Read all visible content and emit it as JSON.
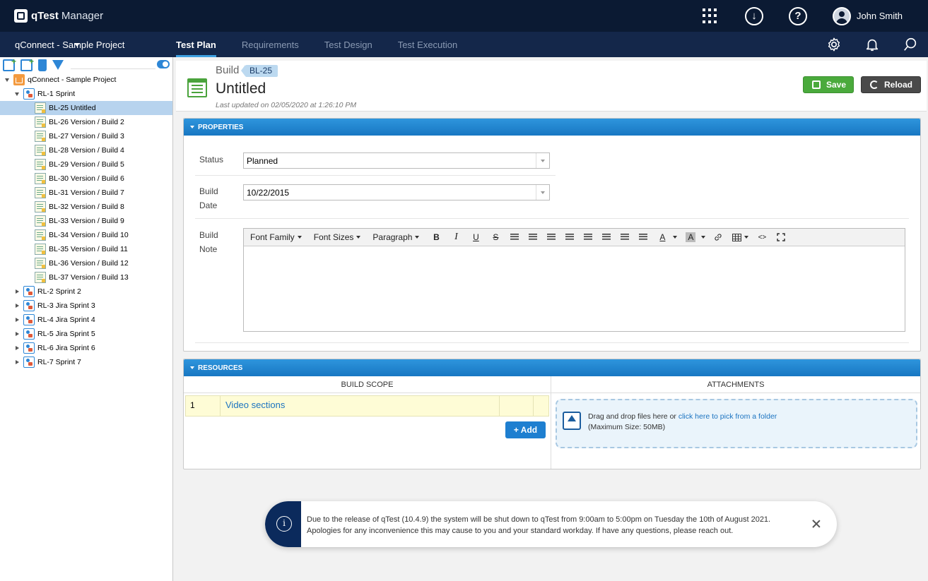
{
  "topbar": {
    "brand": "qTest",
    "product": "Manager",
    "user_name": "John Smith",
    "download_glyph": "↓",
    "help_glyph": "?"
  },
  "navbar": {
    "project": "qConnect - Sample Project",
    "tabs": [
      {
        "label": "Test Plan",
        "active": true
      },
      {
        "label": "Requirements",
        "active": false
      },
      {
        "label": "Test Design",
        "active": false
      },
      {
        "label": "Test Execution",
        "active": false
      }
    ]
  },
  "tree": {
    "root": "qConnect - Sample Project",
    "sprint1": "RL-1 Sprint",
    "builds": [
      "BL-25 Untitled",
      "BL-26 Version / Build 2",
      "BL-27 Version / Build 3",
      "BL-28 Version / Build 4",
      "BL-29 Version / Build 5",
      "BL-30 Version / Build 6",
      "BL-31 Version / Build 7",
      "BL-32 Version / Build 8",
      "BL-33 Version / Build 9",
      "BL-34 Version / Build 10",
      "BL-35 Version / Build 11",
      "BL-36 Version / Build 12",
      "BL-37 Version / Build 13"
    ],
    "releases": [
      "RL-2 Sprint 2",
      "RL-3 Jira Sprint 3",
      "RL-4 Jira Sprint 4",
      "RL-5 Jira Sprint 5",
      "RL-6 Jira Sprint 6",
      "RL-7 Sprint 7"
    ]
  },
  "header": {
    "type": "Build",
    "badge": "BL-25",
    "title": "Untitled",
    "updated": "Last updated on 02/05/2020 at 1:26:10 PM",
    "save_label": "Save",
    "reload_label": "Reload"
  },
  "properties": {
    "heading": "PROPERTIES",
    "status_label": "Status",
    "status_value": "Planned",
    "build_date_label_1": "Build",
    "build_date_label_2": "Date",
    "build_date_value": "10/22/2015",
    "build_note_label_1": "Build",
    "build_note_label_2": "Note",
    "editor": {
      "font_family": "Font Family",
      "font_sizes": "Font Sizes",
      "paragraph": "Paragraph",
      "bold": "B",
      "italic": "I",
      "underline": "U",
      "strike": "S",
      "text_color": "A",
      "bg_color": "A",
      "code": "<>"
    }
  },
  "resources": {
    "heading": "RESOURCES",
    "scope_header": "BUILD SCOPE",
    "attachments_header": "ATTACHMENTS",
    "scope_rows": [
      {
        "num": "1",
        "name": "Video sections"
      }
    ],
    "add_label": "+ Add",
    "drop_text": "Drag and drop files here or ",
    "drop_link": "click here to pick from a folder",
    "drop_max": "(Maximum Size: 50MB)"
  },
  "toast": {
    "line1": "Due to the release of qTest (10.4.9) the system will be shut down to qTest from 9:00am to 5:00pm on Tuesday the 10th of August 2021.",
    "line2": "Apologies for any inconvenience this may cause to you and your standard workday. If have any questions, please reach out.",
    "info_glyph": "i"
  },
  "colors": {
    "topbar": "#0b1a33",
    "navbar": "#14274a",
    "panel_head": "#1e86d0",
    "save": "#4aaa3c",
    "accent_link": "#1b73c0"
  }
}
